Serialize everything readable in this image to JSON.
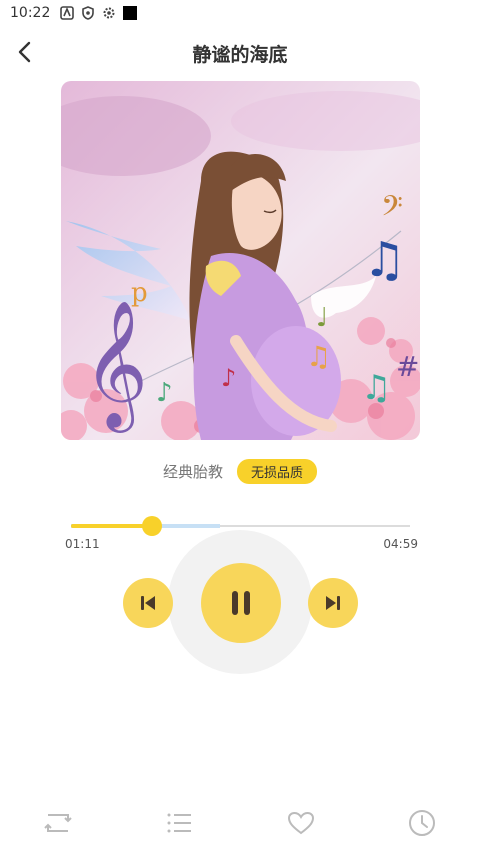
{
  "status_bar": {
    "time": "10:22"
  },
  "header": {
    "title": "静谧的海底"
  },
  "track": {
    "category": "经典胎教",
    "quality_badge": "无损品质"
  },
  "player": {
    "current_time": "01:11",
    "total_time": "04:59",
    "progress": 0.24,
    "buffered": 0.44
  },
  "icons": {
    "back": "chevron-left-icon",
    "prev": "skip-previous-icon",
    "pause": "pause-icon",
    "next": "skip-next-icon",
    "loop": "repeat-icon",
    "playlist": "list-icon",
    "favorite": "heart-icon",
    "timer": "clock-icon"
  },
  "colors": {
    "accent": "#f8d12a",
    "button": "#f8d65a",
    "buffered": "#c7e0f5"
  }
}
